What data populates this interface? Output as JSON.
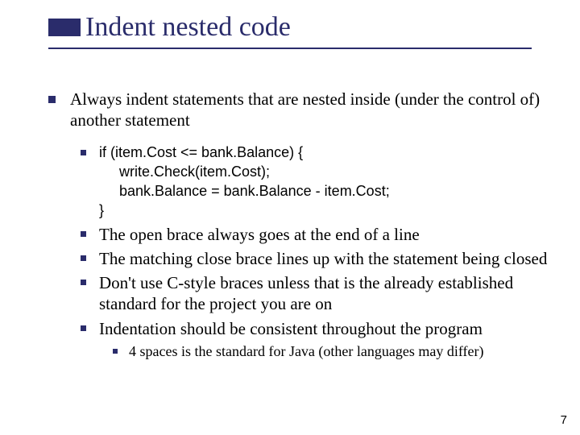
{
  "title": "Indent nested code",
  "bullets": {
    "main": "Always indent statements that are nested inside (under the control of) another statement",
    "code": "if (item.Cost <= bank.Balance) {\n     write.Check(item.Cost);\n     bank.Balance = bank.Balance - item.Cost;\n}",
    "sub1": "The open brace always goes at the end of a line",
    "sub2": "The matching close brace lines up with the statement being closed",
    "sub3": "Don't use C-style braces unless that is the already established standard for the project you are on",
    "sub4": "Indentation should be consistent throughout the program",
    "subsub": "4 spaces is the standard for Java (other languages may differ)"
  },
  "page": "7"
}
